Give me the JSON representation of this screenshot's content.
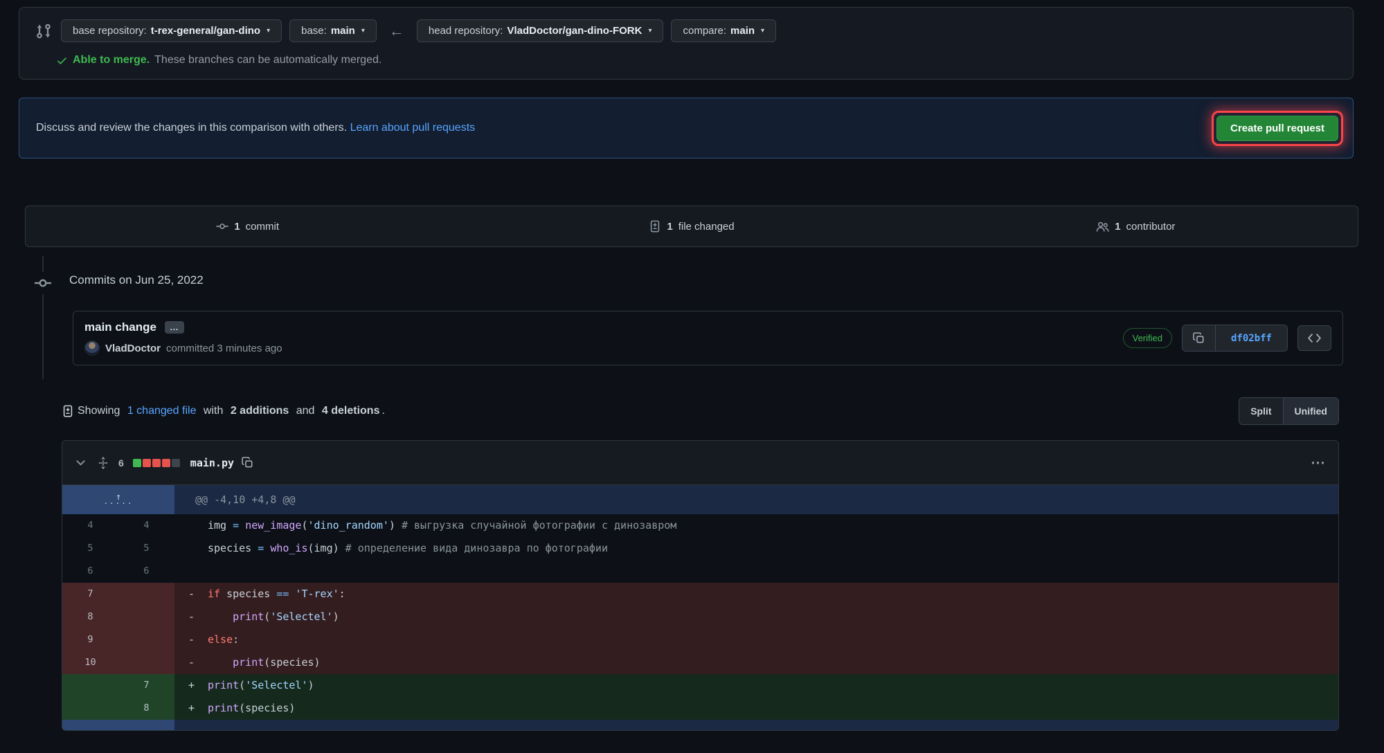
{
  "colors": {
    "accent_blue": "#58a6ff",
    "success_green": "#3fb950",
    "button_green": "#238636",
    "annotation_red": "#fa4549"
  },
  "icons": {
    "caret": "▾",
    "arrow_left": "←",
    "kebab": "⋯",
    "ellipsis": "…",
    "expand_arrow": "↑",
    "expand_dots": "·····"
  },
  "compare_bar": {
    "buttons": [
      {
        "prefix": "base repository:",
        "value": "t-rex-general/gan-dino"
      },
      {
        "prefix": "base:",
        "value": "main"
      },
      {
        "prefix": "head repository:",
        "value": "VladDoctor/gan-dino-FORK"
      },
      {
        "prefix": "compare:",
        "value": "main"
      }
    ],
    "merge_bold": "Able to merge.",
    "merge_rest": "These branches can be automatically merged."
  },
  "banner": {
    "text": "Discuss and review the changes in this comparison with others.",
    "link": "Learn about pull requests",
    "cta": "Create pull request"
  },
  "stats": [
    {
      "count": "1",
      "label": "commit"
    },
    {
      "count": "1",
      "label": "file changed"
    },
    {
      "count": "1",
      "label": "contributor"
    }
  ],
  "commits": {
    "heading": "Commits on Jun 25, 2022",
    "commit": {
      "title": "main change",
      "author": "VladDoctor",
      "meta": "committed 3 minutes ago",
      "verified_label": "Verified",
      "sha": "df02bff"
    }
  },
  "files": {
    "prefix": "Showing",
    "link": "1 changed file",
    "mid": "with",
    "additions": "2 additions",
    "and": "and",
    "deletions": "4 deletions",
    "period": ".",
    "split_label": "Split",
    "unified_label": "Unified"
  },
  "diff": {
    "changes": "6",
    "filename": "main.py",
    "blocks": [
      "add",
      "del",
      "del",
      "del",
      "neutral"
    ],
    "rows": [
      {
        "type": "hunk",
        "text": "@@ -4,10 +4,8 @@"
      },
      {
        "type": "ctx",
        "old": "4",
        "new": "4",
        "tokens": [
          [
            "pl",
            "img "
          ],
          [
            "op",
            "="
          ],
          [
            "pl",
            " "
          ],
          [
            "fn",
            "new_image"
          ],
          [
            "pl",
            "("
          ],
          [
            "st",
            "'dino_random'"
          ],
          [
            "pl",
            ")"
          ],
          [
            "cm",
            " # выгрузка случайной фотографии с динозавром"
          ]
        ]
      },
      {
        "type": "ctx",
        "old": "5",
        "new": "5",
        "tokens": [
          [
            "pl",
            "species "
          ],
          [
            "op",
            "="
          ],
          [
            "pl",
            " "
          ],
          [
            "fn",
            "who_is"
          ],
          [
            "pl",
            "(img)"
          ],
          [
            "cm",
            " # определение вида динозавра по фотографии"
          ]
        ]
      },
      {
        "type": "ctx",
        "old": "6",
        "new": "6",
        "tokens": []
      },
      {
        "type": "del",
        "old": "7",
        "new": "",
        "tokens": [
          [
            "kw",
            "if"
          ],
          [
            "pl",
            " species "
          ],
          [
            "op",
            "=="
          ],
          [
            "pl",
            " "
          ],
          [
            "st",
            "'T-rex'"
          ],
          [
            "pl",
            ":"
          ]
        ]
      },
      {
        "type": "del",
        "old": "8",
        "new": "",
        "tokens": [
          [
            "pl",
            "    "
          ],
          [
            "fn",
            "print"
          ],
          [
            "pl",
            "("
          ],
          [
            "st",
            "'Selectel'"
          ],
          [
            "pl",
            ")"
          ]
        ]
      },
      {
        "type": "del",
        "old": "9",
        "new": "",
        "tokens": [
          [
            "kw",
            "else"
          ],
          [
            "pl",
            ":"
          ]
        ]
      },
      {
        "type": "del",
        "old": "10",
        "new": "",
        "tokens": [
          [
            "pl",
            "    "
          ],
          [
            "fn",
            "print"
          ],
          [
            "pl",
            "(species)"
          ]
        ]
      },
      {
        "type": "add",
        "old": "",
        "new": "7",
        "tokens": [
          [
            "fn",
            "print"
          ],
          [
            "pl",
            "("
          ],
          [
            "st",
            "'Selectel'"
          ],
          [
            "pl",
            ")"
          ]
        ]
      },
      {
        "type": "add",
        "old": "",
        "new": "8",
        "tokens": [
          [
            "fn",
            "print"
          ],
          [
            "pl",
            "(species)"
          ]
        ]
      },
      {
        "type": "hunkcut",
        "text": ""
      }
    ]
  }
}
